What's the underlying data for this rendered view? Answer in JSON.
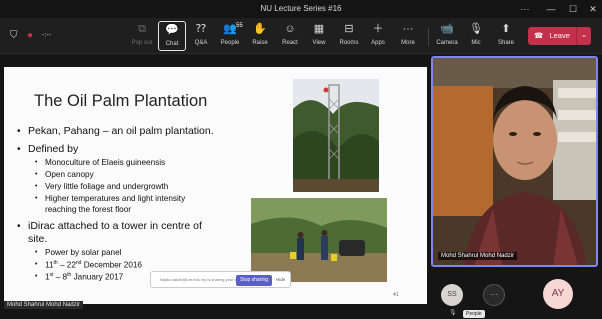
{
  "window": {
    "title": "NU Lecture Series #16"
  },
  "titlebar_controls": {
    "more": "···",
    "minimize": "—",
    "maximize": "☐",
    "close": "✕"
  },
  "left_tools": {
    "shield": "⛉",
    "record": "●",
    "timer": "-:--"
  },
  "toolbar": {
    "pop_out": "Pop out",
    "chat": "Chat",
    "qa": "Q&A",
    "people": "People",
    "people_count": "55",
    "raise": "Raise",
    "react": "React",
    "view": "View",
    "rooms": "Rooms",
    "apps": "Apps",
    "more": "More",
    "camera": "Camera",
    "mic": "Mic",
    "share": "Share",
    "leave": "Leave"
  },
  "icons": {
    "pop_out": "⧉",
    "chat": "💬",
    "qa": "⁇",
    "people": "👥",
    "raise": "✋",
    "react": "☺",
    "view": "▦",
    "rooms": "⊟",
    "apps": "＋",
    "more": "···",
    "camera": "📹",
    "mic": "🎙",
    "share": "⬆",
    "leave": "☎",
    "dropdown": "⌄"
  },
  "slide": {
    "title": "The Oil Palm Plantation",
    "bullets": [
      "Pekan, Pahang – an oil palm plantation.",
      "Defined by",
      "iDirac attached to a tower in centre of"
    ],
    "bullet_cont": "site.",
    "defined_by_items": [
      "Monoculture of Elaeis guineensis",
      "Open canopy",
      "Very little foliage and undergrowth",
      "Higher temperatures and light intensity",
      "reaching the forest floor"
    ],
    "idirac_items": {
      "power": "Power by solar panel",
      "date1_pre": "11",
      "date1_sup1": "th",
      "date1_mid": " – 22",
      "date1_sup2": "nd",
      "date1_post": " December 2016",
      "date2_pre": "1",
      "date2_sup1": "st",
      "date2_mid": " – 8",
      "date2_sup2": "th",
      "date2_post": " January 2017"
    },
    "page_number": "41"
  },
  "share_bar": {
    "message": "Nadia.nadzir@um.edu.my is sharing your screen",
    "stop": "Stop sharing",
    "hide": "Hide"
  },
  "video": {
    "name": "Mohd Shahrul Mohd Nadzir"
  },
  "presenter_tag": "Mohd Shahrul Mohd Nadzir",
  "participants": {
    "ss": "SS",
    "more": "···",
    "ay": "AY",
    "tooltip": "People"
  },
  "colors": {
    "leave": "#c4314b",
    "active_border": "#7f85f5",
    "share_button": "#5b5fc7"
  }
}
